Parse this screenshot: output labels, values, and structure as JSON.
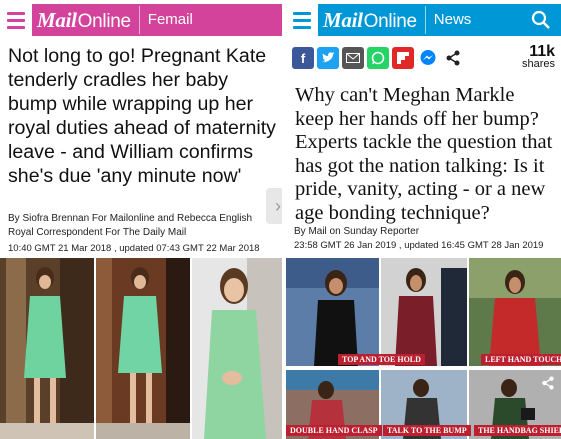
{
  "colors": {
    "femail_header": "#d4439b",
    "news_header": "#0097d6",
    "caption_red": "#ba2030",
    "facebook": "#3b5998",
    "twitter": "#1da1f2",
    "email": "#555555",
    "whatsapp": "#25d366",
    "flipboard": "#e12828",
    "messenger": "#0084ff"
  },
  "left": {
    "logo_mail": "Mail",
    "logo_online": "Online",
    "channel": "Femail",
    "headline": "Not long to go! Pregnant Kate tenderly cradles her baby bump while wrapping up her royal duties ahead of maternity leave - and William confirms she's due 'any minute now'",
    "byline": "By Siofra Brennan For Mailonline and Rebecca English Royal Correspondent For The Daily Mail",
    "timestamp": "10:40 GMT 21 Mar 2018 , updated 07:43 GMT 22 Mar 2018",
    "arrow": "›"
  },
  "right": {
    "logo_mail": "Mail",
    "logo_online": "Online",
    "channel": "News",
    "share_count": "11k",
    "share_label": "shares",
    "headline": "Why can't Meghan Markle keep her hands off her bump? Experts tackle the question that has got the nation talking: Is it pride, vanity, acting - or a new age bonding technique?",
    "byline": "By Mail on Sunday Reporter",
    "timestamp": "23:58 GMT 26 Jan 2019 , updated 16:45 GMT 28 Jan 2019",
    "captions": [
      "TOP AND TOE HOLD",
      "LEFT HAND TOUCH",
      "DOUBLE HAND CLASP",
      "TALK TO THE BUMP",
      "THE HANDBAG SHIELD"
    ]
  }
}
